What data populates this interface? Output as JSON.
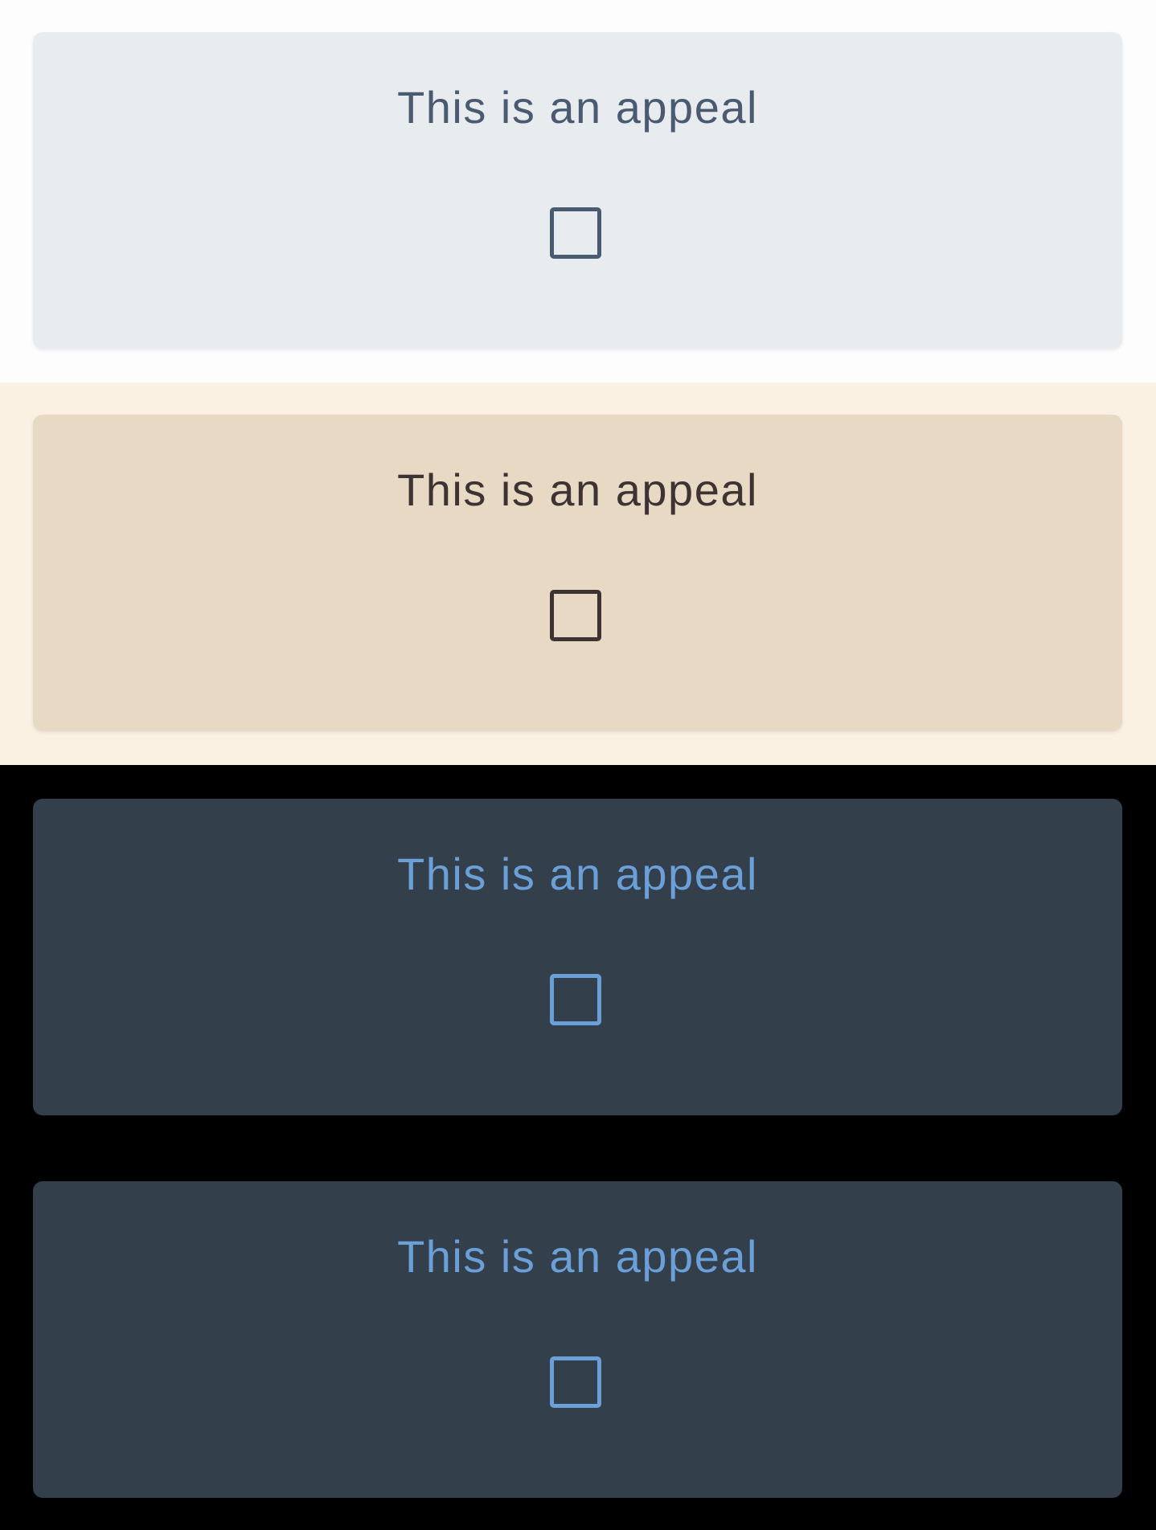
{
  "themes": {
    "light": {
      "background": "#fdfdfd",
      "card_background": "#e9ecef",
      "text_color": "#4a5a70",
      "card": {
        "text": "This is an appeal",
        "checkbox_checked": false
      }
    },
    "sepia": {
      "background": "#fbf1e3",
      "card_background": "#e8d9c4",
      "text_color": "#3d3333",
      "card": {
        "text": "This is an appeal",
        "checkbox_checked": false
      }
    },
    "dark": {
      "background": "#000000",
      "card_background": "#343f4c",
      "text_color": "#6b9fd8",
      "cards": [
        {
          "text": "This is an appeal",
          "checkbox_checked": false
        },
        {
          "text": "This is an appeal",
          "checkbox_checked": false
        }
      ]
    }
  }
}
